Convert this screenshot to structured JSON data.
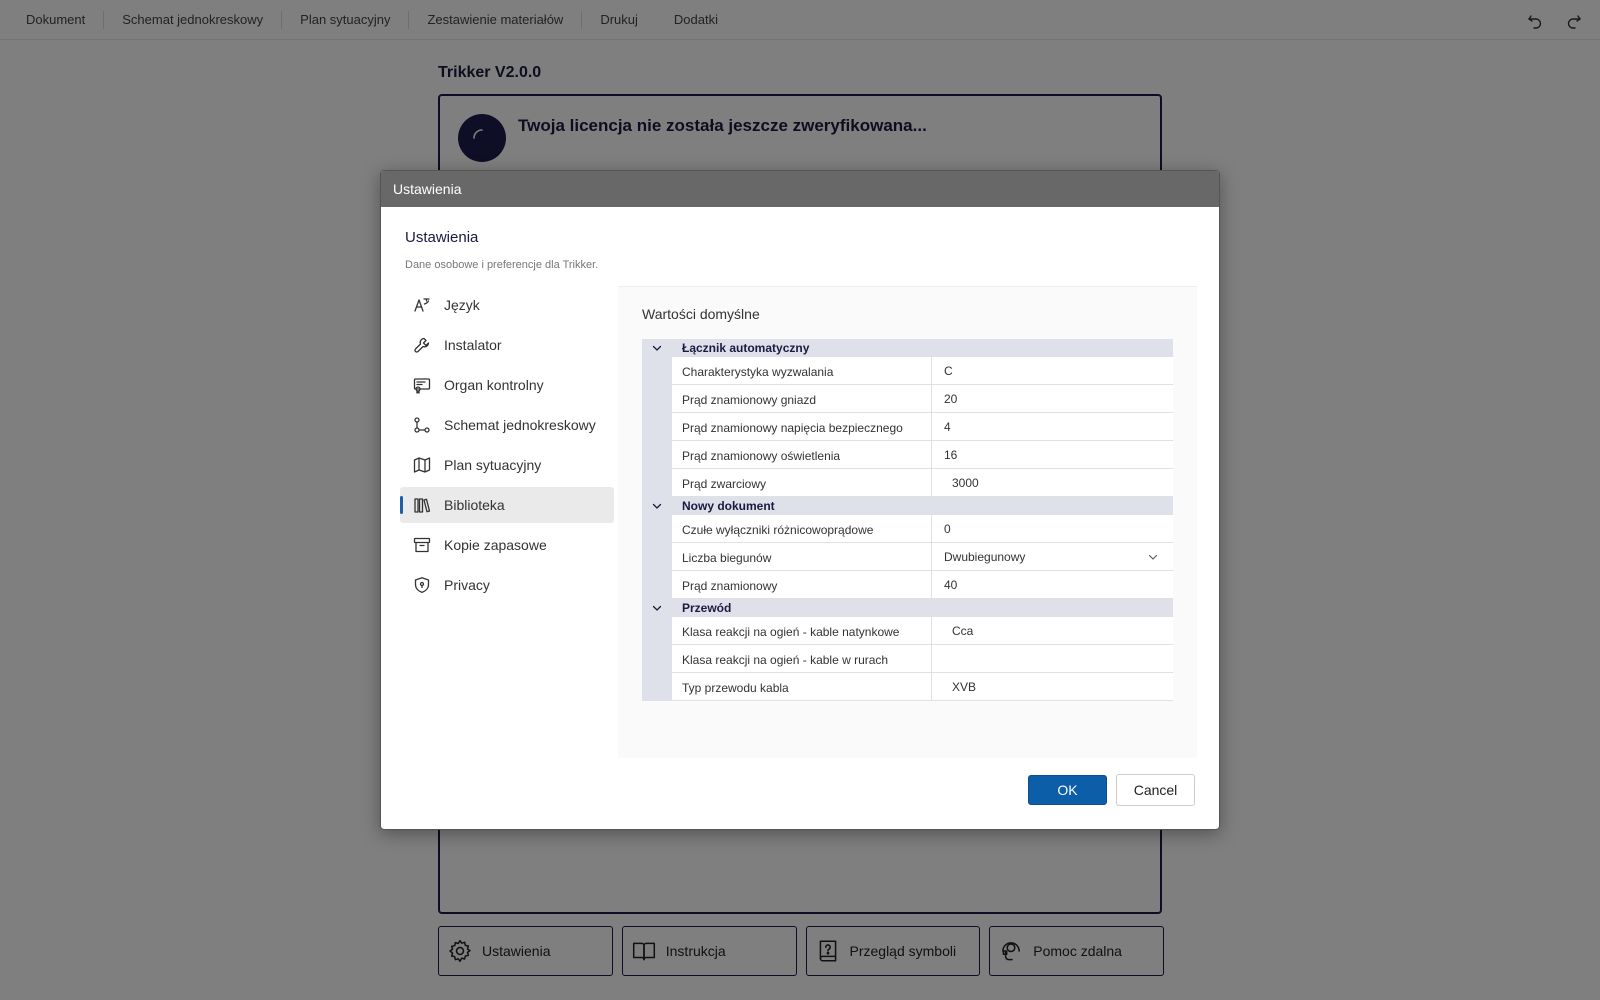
{
  "menubar": {
    "items": [
      "Dokument",
      "Schemat jednokreskowy",
      "Plan sytuacyjny",
      "Zestawienie materiałów",
      "Drukuj",
      "Dodatki"
    ],
    "undo_icon": "undo-icon",
    "redo_icon": "redo-icon"
  },
  "app": {
    "title": "Trikker V2.0.0",
    "license_message": "Twoja licencja nie została jeszcze zweryfikowana..."
  },
  "bottom_buttons": [
    {
      "label": "Ustawienia",
      "icon": "gear-icon"
    },
    {
      "label": "Instrukcja",
      "icon": "book-icon"
    },
    {
      "label": "Przegląd symboli",
      "icon": "help-book-icon"
    },
    {
      "label": "Pomoc zdalna",
      "icon": "remote-help-icon"
    }
  ],
  "dialog": {
    "window_title": "Ustawienia",
    "heading": "Ustawienia",
    "subtitle": "Dane osobowe i preferencje dla Trikker.",
    "nav": [
      {
        "label": "Język",
        "icon": "language-icon",
        "active": false
      },
      {
        "label": "Instalator",
        "icon": "wrench-icon",
        "active": false
      },
      {
        "label": "Organ kontrolny",
        "icon": "certificate-icon",
        "active": false
      },
      {
        "label": "Schemat jednokreskowy",
        "icon": "schema-icon",
        "active": false
      },
      {
        "label": "Plan sytuacyjny",
        "icon": "map-icon",
        "active": false
      },
      {
        "label": "Biblioteka",
        "icon": "library-icon",
        "active": true
      },
      {
        "label": "Kopie zapasowe",
        "icon": "archive-icon",
        "active": false
      },
      {
        "label": "Privacy",
        "icon": "shield-icon",
        "active": false
      }
    ],
    "content_title": "Wartości domyślne",
    "groups": [
      {
        "name": "Łącznik automatyczny",
        "rows": [
          {
            "label": "Charakterystyka wyzwalania",
            "value": "C"
          },
          {
            "label": "Prąd znamionowy gniazd",
            "value": "20"
          },
          {
            "label": "Prąd znamionowy napięcia bezpiecznego",
            "value": "4"
          },
          {
            "label": "Prąd znamionowy oświetlenia",
            "value": "16"
          },
          {
            "label": "Prąd zwarciowy",
            "value": "3000"
          }
        ]
      },
      {
        "name": "Nowy dokument",
        "rows": [
          {
            "label": "Czułe wyłączniki różnicowoprądowe",
            "value": "0"
          },
          {
            "label": "Liczba biegunów",
            "value": "Dwubiegunowy"
          },
          {
            "label": "Prąd znamionowy",
            "value": "40"
          }
        ]
      },
      {
        "name": "Przewód",
        "rows": [
          {
            "label": "Klasa reakcji na ogień - kable natynkowe",
            "value": "Cca"
          },
          {
            "label": "Klasa reakcji na ogień - kable w rurach",
            "value": ""
          },
          {
            "label": "Typ przewodu kabla",
            "value": "XVB"
          }
        ]
      }
    ],
    "ok_label": "OK",
    "cancel_label": "Cancel"
  },
  "colors": {
    "accent": "#0d5ea8",
    "navy": "#1b1b4b",
    "titlebar": "#686868",
    "group_header": "#dfe1ea"
  }
}
